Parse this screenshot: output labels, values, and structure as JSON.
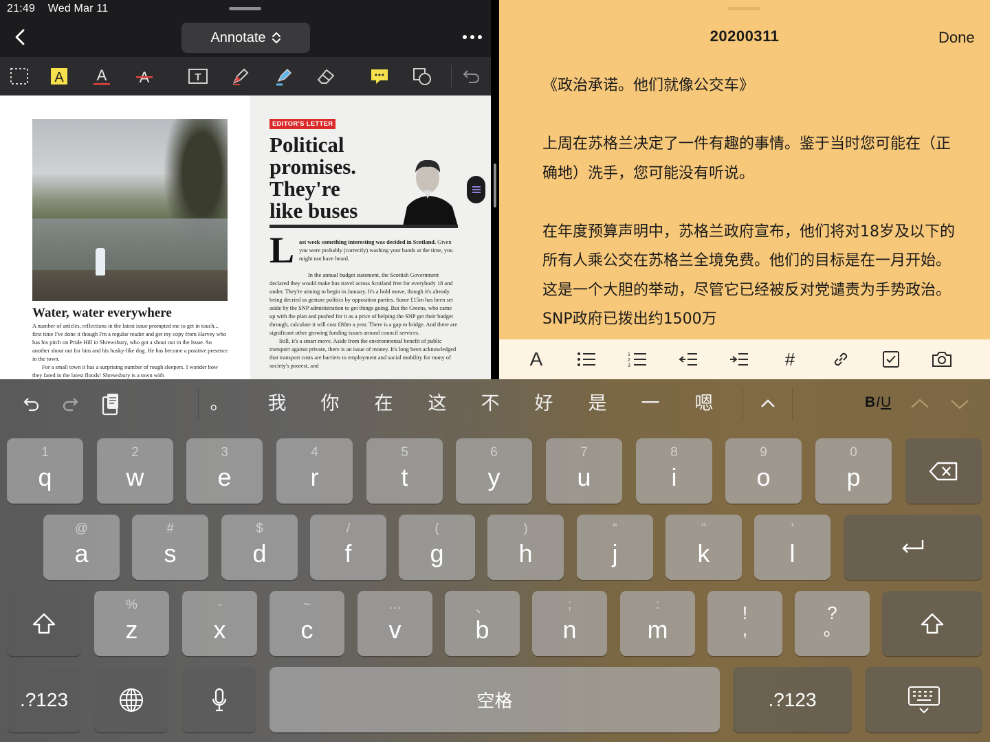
{
  "status": {
    "time": "21:49",
    "date": "Wed Mar 11"
  },
  "left_nav": {
    "mode_label": "Annotate"
  },
  "left_tools": [
    "select-rect-icon",
    "highlight-text-icon",
    "underline-text-icon",
    "strikethrough-text-icon",
    "text-box-icon",
    "pen-icon",
    "highlighter-icon",
    "eraser-icon",
    "note-icon",
    "shape-icon",
    "undo-icon"
  ],
  "doc": {
    "left_title": "Water, water everywhere",
    "left_body": "A number of articles, reflections in the latest issue prompted me to get in touch... first time I've done it though I'm a regular reader and get my copy from Harvey who has his pitch on Pride Hill in Shrewsbury, who got a shout out in the Issue. So another shout out for him and his husky-like dog. He has become a positive presence in the town.",
    "left_body2": "For a small town it has a surprising number of rough sleepers. I wonder how they fared in the latest floods! Shrewsbury is a town with",
    "tag": "EDITOR'S LETTER",
    "headline": "Political\npromises.\nThey're\nlike buses",
    "drop_cap": "L",
    "lead_bold": "ast week something interesting was decided in Scotland.",
    "lead_rest": " Given you were probably (correctly) washing your hands at the time, you might not have heard.",
    "body_p1": "In the annual budget statement, the Scottish Government declared they would make bus travel across Scotland free for everybody 18 and under. They're aiming to begin in January. It's a bold move, though it's already being decried as gesture politics by opposition parties. Some £15m has been set aside by the SNP administration to get things going. But the Greens, who came up with the plan and pushed for it as a price of helping the SNP get their budget through, calculate it will cost £80m a year. There is a gap to bridge. And there are significant other growing funding issues around council services.",
    "body_p2": "Still, it's a smart move. Aside from the environmental benefit of public transport against private, there is an issue of money. It's long been acknowledged that transport costs are barriers to employment and social mobility for many of society's poorest, and"
  },
  "note": {
    "title": "20200311",
    "done_label": "Done",
    "paragraphs": [
      "《政治承诺。他们就像公交车》",
      "上周在苏格兰决定了一件有趣的事情。鉴于当时您可能在（正确地）洗手，您可能没有听说。",
      "在年度预算声明中，苏格兰政府宣布，他们将对18岁及以下的所有人乘公交在苏格兰全境免费。他们的目标是在一月开始。 这是一个大胆的举动，尽管它已经被反对党谴责为手势政治。SNP政府已拨出约1500万"
    ]
  },
  "format_bar": {
    "font_label": "A",
    "tag_label": "#",
    "icons": [
      "font-icon",
      "bullet-list-icon",
      "numbered-list-icon",
      "outdent-icon",
      "indent-icon",
      "tag-icon",
      "link-icon",
      "checkbox-icon",
      "camera-icon"
    ]
  },
  "keyboard": {
    "candidates": [
      "。",
      "我",
      "你",
      "在",
      "这",
      "不",
      "好",
      "是",
      "一",
      "嗯"
    ],
    "format": {
      "bold": "B",
      "italic": "I",
      "underline": "U"
    },
    "row1": [
      {
        "hint": "1",
        "key": "q"
      },
      {
        "hint": "2",
        "key": "w"
      },
      {
        "hint": "3",
        "key": "e"
      },
      {
        "hint": "4",
        "key": "r"
      },
      {
        "hint": "5",
        "key": "t"
      },
      {
        "hint": "6",
        "key": "y"
      },
      {
        "hint": "7",
        "key": "u"
      },
      {
        "hint": "8",
        "key": "i"
      },
      {
        "hint": "9",
        "key": "o"
      },
      {
        "hint": "0",
        "key": "p"
      }
    ],
    "row2": [
      {
        "hint": "@",
        "key": "a"
      },
      {
        "hint": "#",
        "key": "s"
      },
      {
        "hint": "$",
        "key": "d"
      },
      {
        "hint": "/",
        "key": "f"
      },
      {
        "hint": "(",
        "key": "g"
      },
      {
        "hint": ")",
        "key": "h"
      },
      {
        "hint": "“",
        "key": "j"
      },
      {
        "hint": "”",
        "key": "k"
      },
      {
        "hint": "'",
        "key": "l"
      }
    ],
    "row3": [
      {
        "hint": "%",
        "key": "z"
      },
      {
        "hint": "-",
        "key": "x"
      },
      {
        "hint": "~",
        "key": "c"
      },
      {
        "hint": "…",
        "key": "v"
      },
      {
        "hint": "、",
        "key": "b"
      },
      {
        "hint": ";",
        "key": "n"
      },
      {
        "hint": ":",
        "key": "m"
      }
    ],
    "punct1": {
      "top": "!",
      "bottom": ","
    },
    "punct2": {
      "top": "?",
      "bottom": "。"
    },
    "numbers_label": ".?123",
    "space_label": "空格"
  }
}
